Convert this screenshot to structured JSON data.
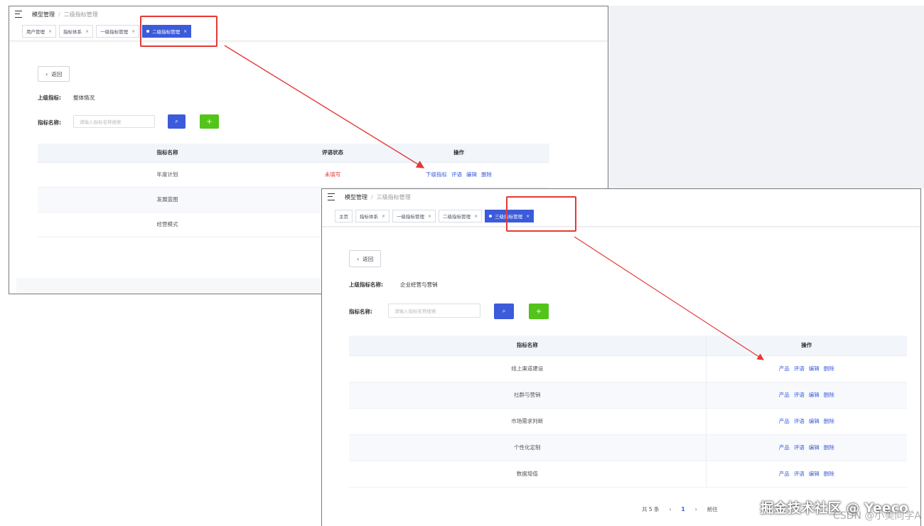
{
  "window1": {
    "breadcrumb": [
      "模型管理",
      "二级指标管理"
    ],
    "tabs": [
      {
        "label": "用户管理"
      },
      {
        "label": "指标体系"
      },
      {
        "label": "一级指标管理"
      },
      {
        "label": "二级指标管理",
        "active": true
      }
    ],
    "back_label": "返回",
    "parent_label": "上级指标:",
    "parent_value": "整体情况",
    "name_label": "指标名称:",
    "search_placeholder": "请输入指标名称搜索",
    "columns": [
      "指标名称",
      "评语状态",
      "操作"
    ],
    "rows": [
      {
        "name": "年度计划",
        "status": "未填写"
      },
      {
        "name": "发展蓝图",
        "status": ""
      },
      {
        "name": "经营模式",
        "status": ""
      }
    ],
    "actions": [
      "下级指标",
      "评语",
      "编辑",
      "删除"
    ]
  },
  "window2": {
    "breadcrumb": [
      "模型管理",
      "三级指标管理"
    ],
    "tabs": [
      {
        "label": "主页"
      },
      {
        "label": "指标体系"
      },
      {
        "label": "一级指标管理"
      },
      {
        "label": "二级指标管理"
      },
      {
        "label": "三级指标管理",
        "active": true
      }
    ],
    "back_label": "返回",
    "parent_label": "上级指标名称:",
    "parent_value": "企业经营与营销",
    "name_label": "指标名称:",
    "search_placeholder": "请输入指标名称搜索",
    "columns": [
      "指标名称",
      "操作"
    ],
    "rows": [
      {
        "name": "线上渠道建设"
      },
      {
        "name": "社群与营销"
      },
      {
        "name": "市场需求判断"
      },
      {
        "name": "个性化定制"
      },
      {
        "name": "数据增值"
      }
    ],
    "actions": [
      "产品",
      "评语",
      "编辑",
      "删除"
    ],
    "pagination": {
      "total": "共 5 条",
      "prev": "‹",
      "page": "1",
      "next": "›",
      "goto": "前往"
    }
  },
  "watermark": {
    "text": "掘金技术社区 @ Yeeco",
    "text2": "CSDN @小美同学A"
  },
  "colors": {
    "primary": "#3b5bdb",
    "add": "#52c41a",
    "highlight": "#e53935"
  },
  "icons": {
    "menu": "hamburger-icon",
    "search": "search-icon",
    "add": "plus-icon",
    "back": "chevron-left-icon",
    "close": "close-icon"
  }
}
